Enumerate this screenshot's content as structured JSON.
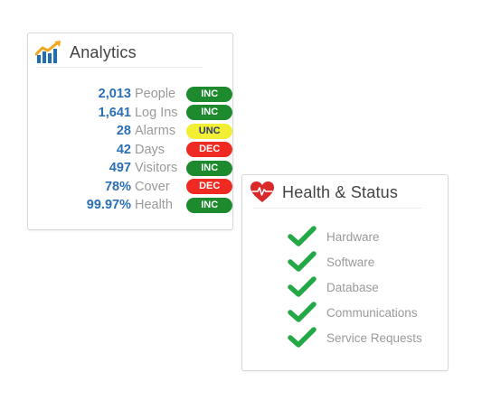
{
  "analytics": {
    "title": "Analytics",
    "icon": "bar-chart-trend-icon",
    "metrics": [
      {
        "value": "2,013",
        "label": "People",
        "status": "INC"
      },
      {
        "value": "1,641",
        "label": "Log Ins",
        "status": "INC"
      },
      {
        "value": "28",
        "label": "Alarms",
        "status": "UNC"
      },
      {
        "value": "42",
        "label": "Days",
        "status": "DEC"
      },
      {
        "value": "497",
        "label": "Visitors",
        "status": "INC"
      },
      {
        "value": "78%",
        "label": "Cover",
        "status": "DEC"
      },
      {
        "value": "99.97%",
        "label": "Health",
        "status": "INC"
      }
    ]
  },
  "health": {
    "title": "Health & Status",
    "icon": "heart-pulse-icon",
    "items": [
      {
        "label": "Hardware",
        "icon": "check-icon"
      },
      {
        "label": "Software",
        "icon": "check-icon"
      },
      {
        "label": "Database",
        "icon": "check-icon"
      },
      {
        "label": "Communications",
        "icon": "check-icon"
      },
      {
        "label": "Service Requests",
        "icon": "check-icon"
      }
    ]
  },
  "colors": {
    "value_blue": "#2b6fb5",
    "inc_green": "#1d8a2e",
    "dec_red": "#ee2a22",
    "unc_yellow": "#f2ee33",
    "check_green": "#22a845",
    "heart_red": "#d9292b"
  }
}
